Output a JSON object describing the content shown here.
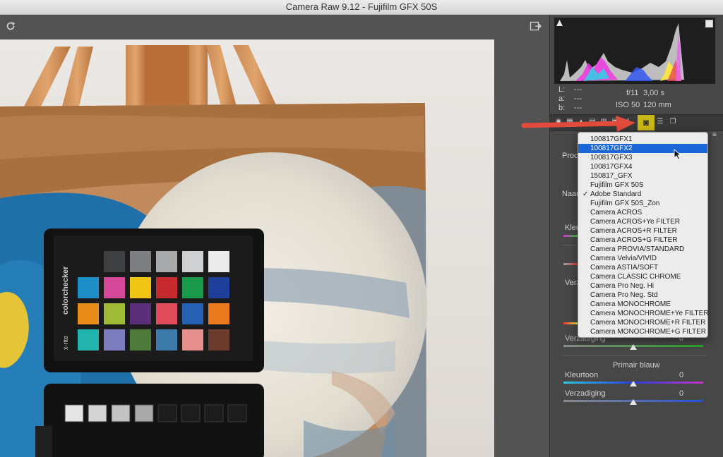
{
  "window": {
    "title": "Camera Raw 9.12  -  Fujifilm GFX 50S"
  },
  "toolbar": {
    "rotate_icon": "rotate-icon",
    "export_icon": "export-icon"
  },
  "readout": {
    "l_label": "L:",
    "l_value": "---",
    "a_label": "a:",
    "a_value": "---",
    "b_label": "b:",
    "b_value": "---",
    "aperture": "f/11",
    "shutter": "3,00 s",
    "iso": "ISO 50",
    "focal": "120 mm"
  },
  "panel": {
    "proces_label": "Proce",
    "naam_label": "Naam",
    "kleurtoon1": "Kleurt",
    "verzadiging_cut": "Verza",
    "verzadiging_full": "Verzadiging",
    "verzadiging_value": "0",
    "primair_blauw": "Primair blauw",
    "kleurtoon_label": "Kleurtoon",
    "kleurtoon_value": "0",
    "verzadiging2_label": "Verzadiging",
    "verzadiging2_value": "0"
  },
  "profile_menu": {
    "selected_index": 1,
    "checked_index": 6,
    "items": [
      "100817GFX1",
      "100817GFX2",
      "100817GFX3",
      "100817GFX4",
      "150817_GFX",
      "Fujifilm GFX 50S",
      "Adobe Standard",
      "Fujifilm GFX 50S_Zon",
      "Camera ACROS",
      "Camera ACROS+Ye FILTER",
      "Camera ACROS+R FILTER",
      "Camera ACROS+G FILTER",
      "Camera PROVIA/STANDARD",
      "Camera Velvia/VIVID",
      "Camera ASTIA/SOFT",
      "Camera CLASSIC CHROME",
      "Camera Pro Neg. Hi",
      "Camera Pro Neg. Std",
      "Camera MONOCHROME",
      "Camera MONOCHROME+Ye FILTER",
      "Camera MONOCHROME+R FILTER",
      "Camera MONOCHROME+G FILTER"
    ],
    "checkmark": "✓"
  },
  "colorchecker": {
    "brand": "colorchecker",
    "maker": "x-rite",
    "swatches": [
      "#1b1b1c",
      "#3e4042",
      "#7d7f82",
      "#a7a9ab",
      "#cfd0d1",
      "#ebebeb",
      "#1d8fc8",
      "#d6499a",
      "#f1c515",
      "#c72a2e",
      "#1a9a4a",
      "#1f3f9a",
      "#e88c1a",
      "#9fbb36",
      "#5b2e7a",
      "#e04c5b",
      "#2560b2",
      "#ea7a1e",
      "#23b4ad",
      "#7b7dbf",
      "#4d7a3a",
      "#3b7aa9",
      "#e58f8f",
      "#6b3b2c"
    ],
    "lower_swatches": [
      "#e5e5e5",
      "#d4d4d4",
      "#c2c2c2",
      "#a9a9a9",
      "#1c1c1c",
      "#1c1c1c",
      "#1c1c1c",
      "#1c1c1c"
    ]
  },
  "colors": {
    "accent": "#c9b715",
    "menu_selected": "#1b67d8",
    "arrow": "#e24a3b"
  }
}
